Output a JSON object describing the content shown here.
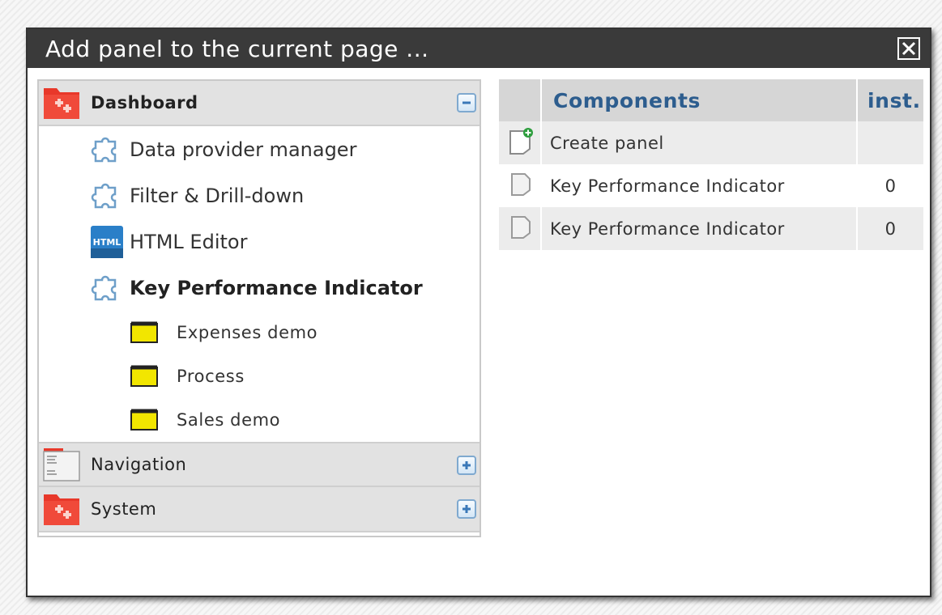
{
  "dialog": {
    "title": "Add panel to the current page ...",
    "close_icon": "close-icon"
  },
  "tree": {
    "groups": [
      {
        "label": "Dashboard",
        "icon": "red-folder-icon",
        "expanded": true,
        "toggle": "collapse",
        "items": [
          {
            "label": "Data provider manager",
            "icon": "puzzle-icon"
          },
          {
            "label": "Filter & Drill-down",
            "icon": "puzzle-icon"
          },
          {
            "label": "HTML Editor",
            "icon": "html-icon"
          },
          {
            "label": "Key Performance Indicator",
            "icon": "puzzle-icon",
            "selected": true,
            "children": [
              {
                "label": "Expenses demo",
                "icon": "yellow-folder-icon"
              },
              {
                "label": "Process",
                "icon": "yellow-folder-icon"
              },
              {
                "label": "Sales demo",
                "icon": "yellow-folder-icon"
              }
            ]
          }
        ]
      },
      {
        "label": "Navigation",
        "icon": "navigation-icon",
        "expanded": false,
        "toggle": "expand"
      },
      {
        "label": "System",
        "icon": "red-folder-icon",
        "expanded": false,
        "toggle": "expand"
      }
    ]
  },
  "components": {
    "headers": {
      "components": "Components",
      "inst": "inst."
    },
    "rows": [
      {
        "icon": "create-panel-icon",
        "label": "Create panel",
        "inst": ""
      },
      {
        "icon": "panel-icon",
        "label": "Key Performance Indicator",
        "inst": "0"
      },
      {
        "icon": "panel-icon",
        "label": "Key Performance Indicator",
        "inst": "0"
      }
    ]
  },
  "colors": {
    "titlebar": "#3a3a3a",
    "header_text": "#2d5d8e",
    "folder_red": "#e8382a",
    "folder_yellow": "#f2e600"
  }
}
